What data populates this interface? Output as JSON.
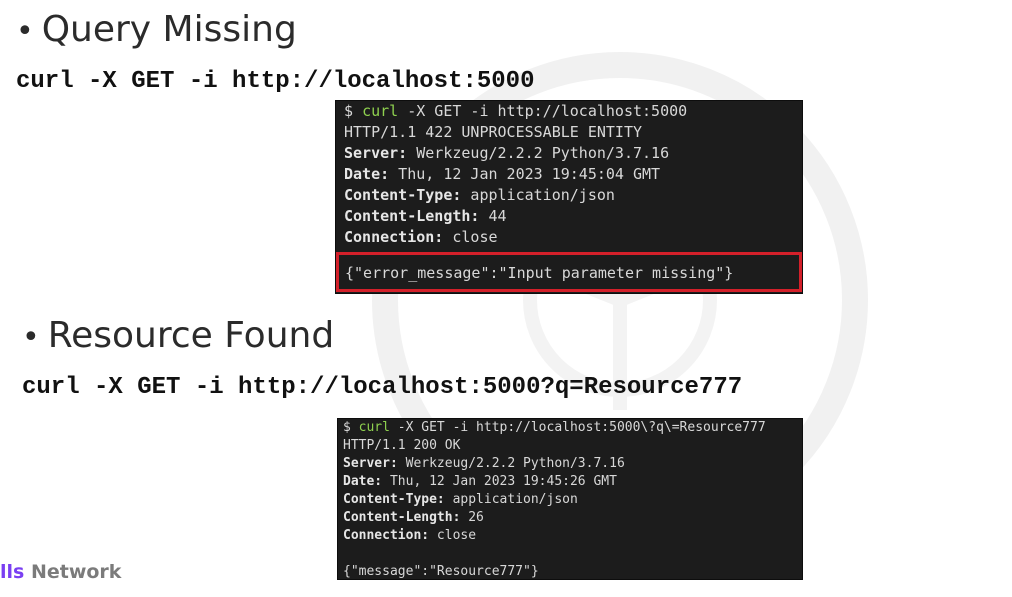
{
  "section1": {
    "bullet": "•",
    "heading": "Query Missing",
    "command": "curl -X GET -i http://localhost:5000",
    "terminal": {
      "prompt_symbol": "$ ",
      "prompt_cmd": "curl",
      "prompt_rest": " -X GET -i http://localhost:5000",
      "status_line": "HTTP/1.1 422 UNPROCESSABLE ENTITY",
      "headers": [
        {
          "key": "Server:",
          "value": " Werkzeug/2.2.2 Python/3.7.16"
        },
        {
          "key": "Date:",
          "value": " Thu, 12 Jan 2023 19:45:04 GMT"
        },
        {
          "key": "Content-Type:",
          "value": " application/json"
        },
        {
          "key": "Content-Length:",
          "value": " 44"
        },
        {
          "key": "Connection:",
          "value": " close"
        }
      ],
      "body": "{\"error_message\":\"Input parameter missing\"}"
    }
  },
  "section2": {
    "bullet": "•",
    "heading": "Resource Found",
    "command": "curl -X GET -i http://localhost:5000?q=Resource777",
    "terminal": {
      "prompt_symbol": "$ ",
      "prompt_cmd": "curl",
      "prompt_rest": " -X GET -i http://localhost:5000\\?q\\=Resource777",
      "status_line": "HTTP/1.1 200 OK",
      "headers": [
        {
          "key": "Server:",
          "value": " Werkzeug/2.2.2 Python/3.7.16"
        },
        {
          "key": "Date:",
          "value": " Thu, 12 Jan 2023 19:45:26 GMT"
        },
        {
          "key": "Content-Type:",
          "value": " application/json"
        },
        {
          "key": "Content-Length:",
          "value": " 26"
        },
        {
          "key": "Connection:",
          "value": " close"
        }
      ],
      "body": "{\"message\":\"Resource777\"}"
    }
  },
  "brand": {
    "accent": "lls",
    "rest": " Network"
  },
  "colors": {
    "error_highlight": "#d4202a",
    "terminal_bg": "#1c1c1c",
    "prompt_green": "#8fd14f",
    "brand_purple": "#7a3ff2"
  }
}
